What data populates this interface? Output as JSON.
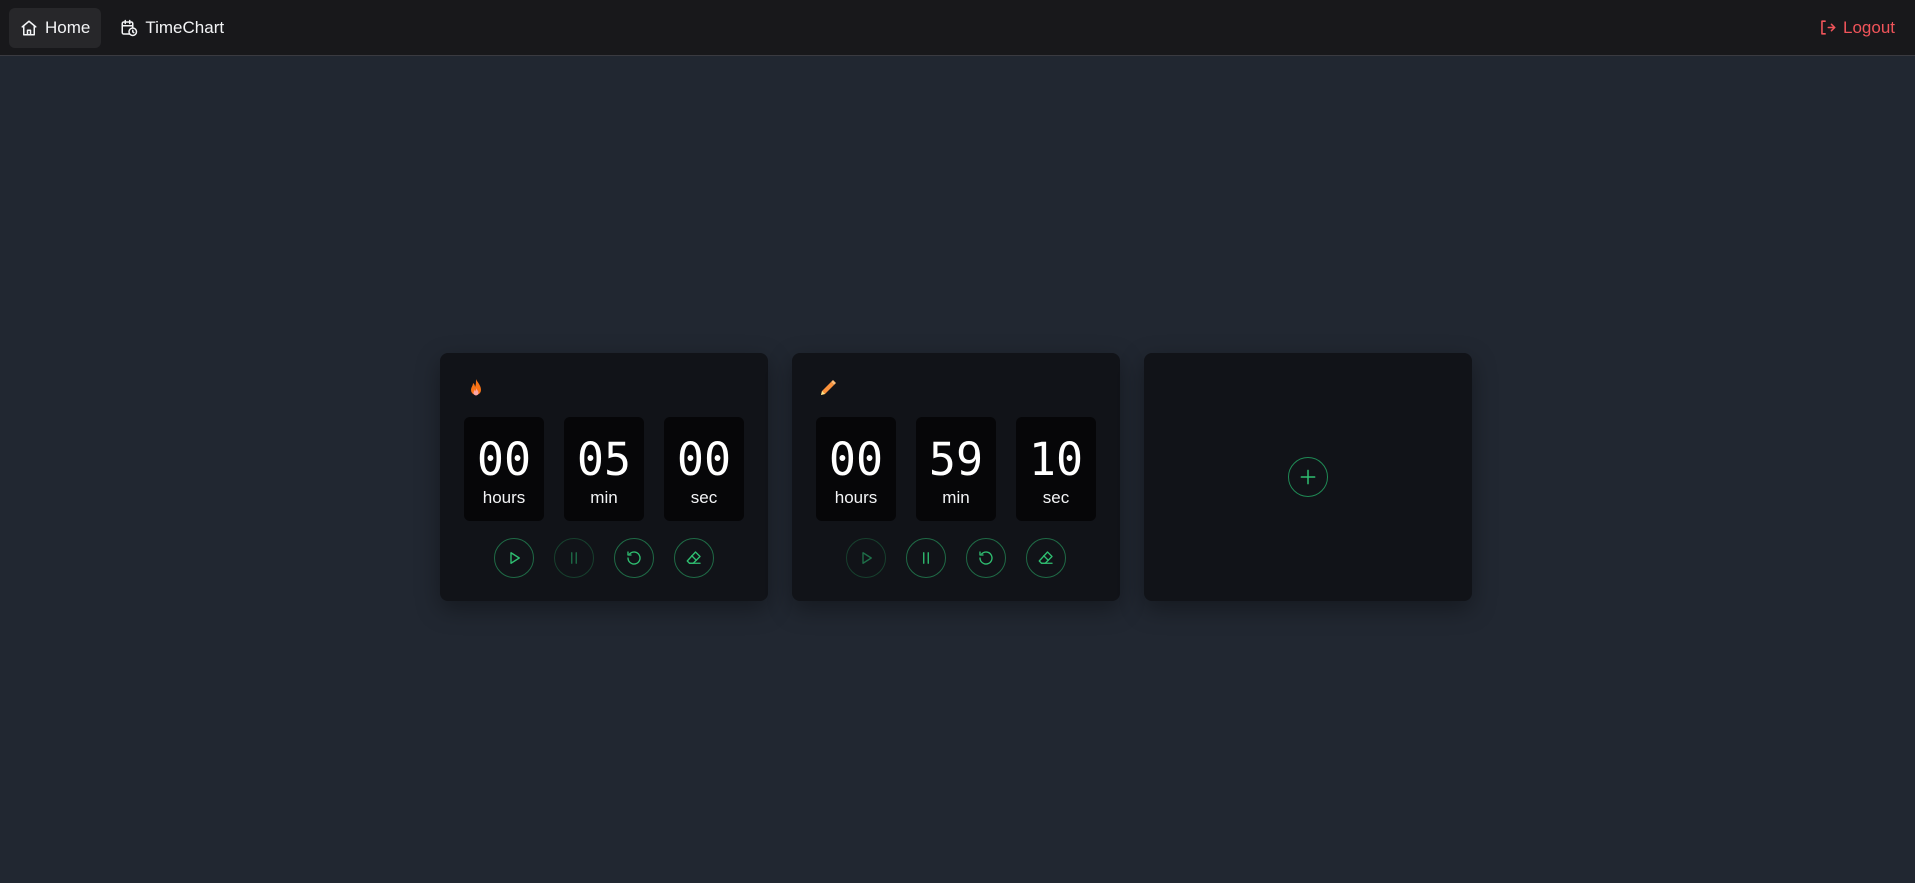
{
  "nav": {
    "home_label": "Home",
    "timechart_label": "TimeChart",
    "logout_label": "Logout"
  },
  "timers": [
    {
      "icon": "flame-icon",
      "hours": "00",
      "minutes": "05",
      "seconds": "00",
      "hours_label": "hours",
      "minutes_label": "min",
      "seconds_label": "sec",
      "state": "paused"
    },
    {
      "icon": "pencil-icon",
      "hours": "00",
      "minutes": "59",
      "seconds": "10",
      "hours_label": "hours",
      "minutes_label": "min",
      "seconds_label": "sec",
      "state": "running"
    }
  ],
  "colors": {
    "background": "#212731",
    "navbar": "#18181b",
    "card": "#111318",
    "accent_green": "#22c55e",
    "logout_red": "#f0545a",
    "flame_orange": "#f97316",
    "pencil_orange": "#fb923c"
  }
}
